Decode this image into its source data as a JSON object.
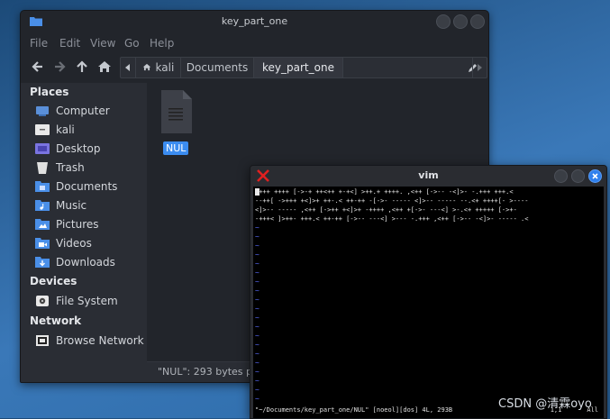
{
  "file_manager": {
    "title": "key_part_one",
    "menu": [
      "File",
      "Edit",
      "View",
      "Go",
      "Help"
    ],
    "pathbar": {
      "crumbs": [
        "kali",
        "Documents",
        "key_part_one"
      ],
      "active": "key_part_one"
    },
    "sidebar": {
      "places_header": "Places",
      "places": [
        {
          "label": "Computer",
          "icon": "computer-icon"
        },
        {
          "label": "kali",
          "icon": "home-folder-icon"
        },
        {
          "label": "Desktop",
          "icon": "desktop-folder-icon"
        },
        {
          "label": "Trash",
          "icon": "trash-icon"
        },
        {
          "label": "Documents",
          "icon": "documents-folder-icon"
        },
        {
          "label": "Music",
          "icon": "music-folder-icon"
        },
        {
          "label": "Pictures",
          "icon": "pictures-folder-icon"
        },
        {
          "label": "Videos",
          "icon": "videos-folder-icon"
        },
        {
          "label": "Downloads",
          "icon": "downloads-folder-icon"
        }
      ],
      "devices_header": "Devices",
      "devices": [
        {
          "label": "File System",
          "icon": "drive-icon"
        }
      ],
      "network_header": "Network",
      "network": [
        {
          "label": "Browse Network",
          "icon": "network-icon"
        }
      ]
    },
    "files": [
      {
        "name": "NUL",
        "selected": true
      }
    ],
    "status": "\"NUL\": 293 bytes pl"
  },
  "vim": {
    "title": "vim",
    "lines": [
      "++++ ++++ [->-+ ++<++ +-+<] >++.+ ++++. ,<++ [->-- -<]>- -.+++ +++.<",
      "--++[ ->+++ +<]>+ ++-.< ++-++ -[->- ----- <]>-- ----- --.<+ ++++[- >----",
      "<]>-- ----- ,<++ [->++ +<]>+ -++++ ,<++ +[->- ---<] >-.<+ +++++ [->+-",
      "-+++< ]>++- +++.< ++-++ [->-- ---<] >--- -.+++ ,<++ [->-- -<]>- ----- .<"
    ],
    "status_line": "\"~/Documents/key_part_one/NUL\" [noeol][dos] 4L, 293B",
    "position": "1,1",
    "scroll": "All"
  },
  "watermark": "CSDN @清霖oyo",
  "colors": {
    "accent": "#3b8cf0",
    "close_button": "#2f80ed",
    "vim_tilde": "#5a6cff",
    "vim_x_logo": "#e02020"
  }
}
